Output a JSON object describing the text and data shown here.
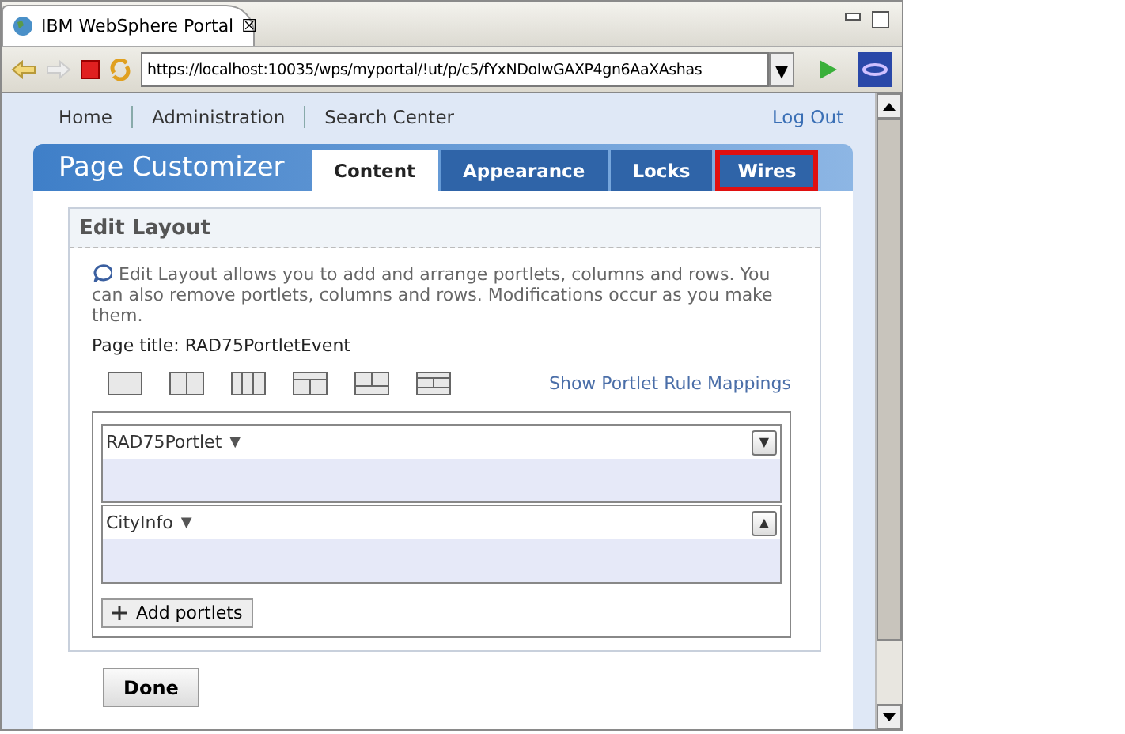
{
  "browser": {
    "tab_title": "IBM WebSphere Portal",
    "tab_close": "☒",
    "url": "https://localhost:10035/wps/myportal/!ut/p/c5/fYxNDoIwGAXP4gn6AaXAshas",
    "url_dropdown": "▾"
  },
  "nav": {
    "links": [
      "Home",
      "Administration",
      "Search Center"
    ],
    "logout": "Log Out"
  },
  "header": {
    "title": "Page Customizer",
    "tabs": [
      {
        "label": "Content",
        "selected": true,
        "highlighted": false
      },
      {
        "label": "Appearance",
        "selected": false,
        "highlighted": false
      },
      {
        "label": "Locks",
        "selected": false,
        "highlighted": false
      },
      {
        "label": "Wires",
        "selected": false,
        "highlighted": true
      }
    ]
  },
  "edit_layout": {
    "title": "Edit Layout",
    "help": "Edit Layout allows you to add and arrange portlets, columns and rows. You can also remove portlets, columns and rows. Modifications occur as you make them.",
    "page_title": "Page title: RAD75PortletEvent",
    "rule_link": "Show Portlet Rule Mappings",
    "portlets": [
      {
        "name": "RAD75Portlet",
        "menu": "▼",
        "move": "▼"
      },
      {
        "name": "CityInfo",
        "menu": "▼",
        "move": "▲"
      }
    ],
    "add_label": "Add portlets"
  },
  "done": "Done"
}
